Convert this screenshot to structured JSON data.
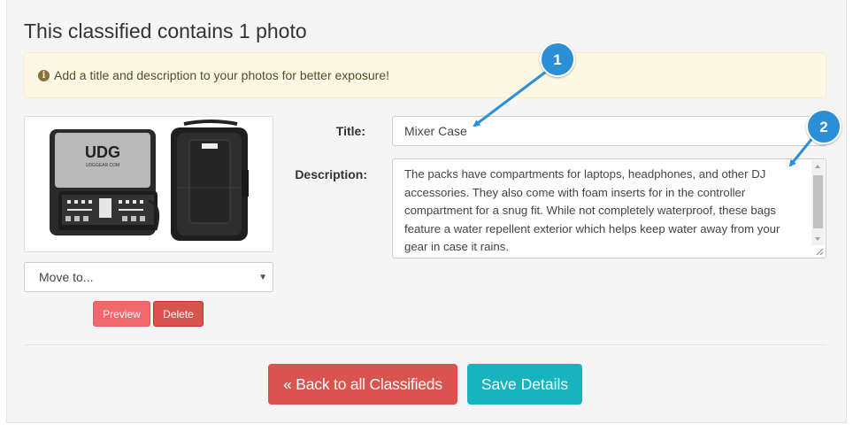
{
  "heading": "This classified contains 1 photo",
  "alert": {
    "icon": "info-circle-icon",
    "text": "Add a title and description to your photos for better exposure!"
  },
  "photo": {
    "brand_logo": "UDG",
    "brand_sub": "UDGGEAR.COM",
    "move_select": {
      "value": "Move to..."
    },
    "preview_label": "Preview",
    "delete_label": "Delete"
  },
  "form": {
    "title_label": "Title:",
    "title_value": "Mixer Case",
    "description_label": "Description:",
    "description_value": "The packs have compartments for laptops, headphones, and other DJ accessories. They also come with foam inserts for in the controller compartment for a snug fit. While not completely waterproof, these bags feature a water repellent exterior which helps keep water away from your gear in case it rains."
  },
  "actions": {
    "back_label": "« Back to all Classifieds",
    "save_label": "Save Details"
  },
  "callouts": [
    {
      "number": "1"
    },
    {
      "number": "2"
    }
  ],
  "colors": {
    "alert_bg": "#fcf8e3",
    "danger": "#d9534f",
    "preview": "#f0686c",
    "save": "#17b3bf",
    "callout": "#2a8fd4"
  }
}
